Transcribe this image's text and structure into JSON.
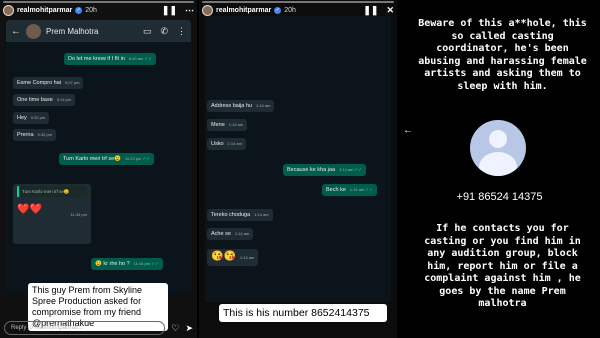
{
  "story": {
    "username": "realmohitparmar",
    "time": "20h",
    "reply_placeholder": "Reply to realmohitparmar..."
  },
  "chat1": {
    "contact_name": "Prem Malhotra",
    "messages": [
      {
        "text": "Do let me know if I fit in",
        "time": "6:43 am",
        "dir": "out"
      },
      {
        "text": "Esme Compro hai",
        "time": "9:07 pm",
        "dir": "in"
      },
      {
        "text": "One time base",
        "time": "9:14 pm",
        "dir": "in"
      },
      {
        "text": "Hey",
        "time": "9:32 pm",
        "dir": "in"
      },
      {
        "text": "Prerna",
        "time": "9:32 pm",
        "dir": "in"
      },
      {
        "text": "Tum Karlo meri trf se😉",
        "time": "11:23 pm",
        "dir": "out"
      },
      {
        "text": "Tum Karlo meri trf se😉",
        "time": "",
        "dir": "quote"
      },
      {
        "text": "❤️❤️",
        "time": "11:34 pm",
        "dir": "in"
      },
      {
        "text": "😉 kr rhe ho ?",
        "time": "11:44 pm",
        "dir": "out"
      }
    ],
    "caption": "This guy Prem from Skyline Spree Production asked for compromise from my friend @prernathakue"
  },
  "chat2": {
    "messages": [
      {
        "text": "Address baija hu",
        "time": "1:14 am",
        "dir": "in"
      },
      {
        "text": "Mene",
        "time": "1:14 am",
        "dir": "in"
      },
      {
        "text": "Usko",
        "time": "1:14 am",
        "dir": "in"
      },
      {
        "text": "Because ke kha jaa",
        "time": "1:14 am",
        "dir": "out"
      },
      {
        "text": "Bech ke",
        "time": "1:14 am",
        "dir": "out"
      },
      {
        "text": "Tereko choduga",
        "time": "1:14 am",
        "dir": "in"
      },
      {
        "text": "Ache se",
        "time": "1:14 am",
        "dir": "in"
      },
      {
        "text": "😘😘",
        "time": "1:14 am",
        "dir": "in"
      }
    ],
    "caption": "This is his number  8652414375"
  },
  "warning": {
    "top": "Beware of this a**hole, this so called casting coordinator, he's been abusing and harassing female artists and asking them to sleep with him.",
    "phone": "+91 86524 14375",
    "bottom": "If  he contacts you for casting or you find him in any audition group, block him, report him or file a complaint against him , he goes by the name Prem malhotra"
  }
}
